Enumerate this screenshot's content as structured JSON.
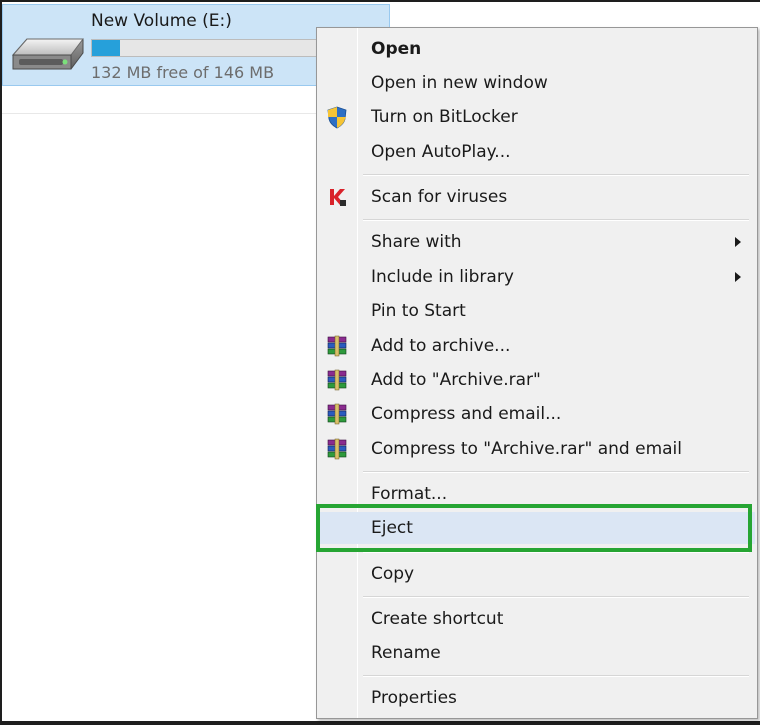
{
  "drive": {
    "name": "New Volume (E:)",
    "space_text": "132 MB free of 146 MB",
    "used_fraction": 0.096,
    "icon": "hard-drive-icon"
  },
  "context_menu": {
    "items": [
      {
        "label": "Open",
        "bold": true
      },
      {
        "label": "Open in new window"
      },
      {
        "label": "Turn on BitLocker",
        "icon": "shield-icon"
      },
      {
        "label": "Open AutoPlay..."
      },
      {
        "label": "Scan for viruses",
        "icon": "kaspersky-icon"
      },
      {
        "label": "Share with",
        "submenu": true
      },
      {
        "label": "Include in library",
        "submenu": true
      },
      {
        "label": "Pin to Start"
      },
      {
        "label": "Add to archive...",
        "icon": "winrar-icon"
      },
      {
        "label": "Add to \"Archive.rar\"",
        "icon": "winrar-icon"
      },
      {
        "label": "Compress and email...",
        "icon": "winrar-icon"
      },
      {
        "label": "Compress to \"Archive.rar\" and email",
        "icon": "winrar-icon"
      },
      {
        "label": "Format..."
      },
      {
        "label": "Eject",
        "highlighted": true
      },
      {
        "label": "Copy"
      },
      {
        "label": "Create shortcut"
      },
      {
        "label": "Rename"
      },
      {
        "label": "Properties"
      }
    ]
  },
  "colors": {
    "selection": "#cce4f7",
    "menu_background": "#f0f0f0",
    "highlight": "#dbe6f4",
    "callout": "#26a533",
    "progress": "#26a0da"
  }
}
